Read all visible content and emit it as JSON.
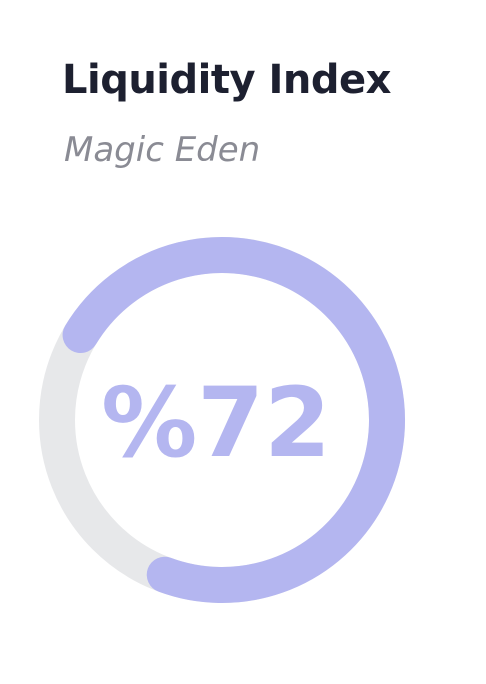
{
  "widget": {
    "title": "Liquidity Index",
    "subtitle": "Magic Eden",
    "value_label": "%72",
    "value_fraction": 0.72
  },
  "colors": {
    "title": "#1d2030",
    "subtitle": "#8a8b94",
    "progress": "#b4b6f0",
    "track": "#e7e8ea",
    "value_text": "#b4b6f0"
  }
}
